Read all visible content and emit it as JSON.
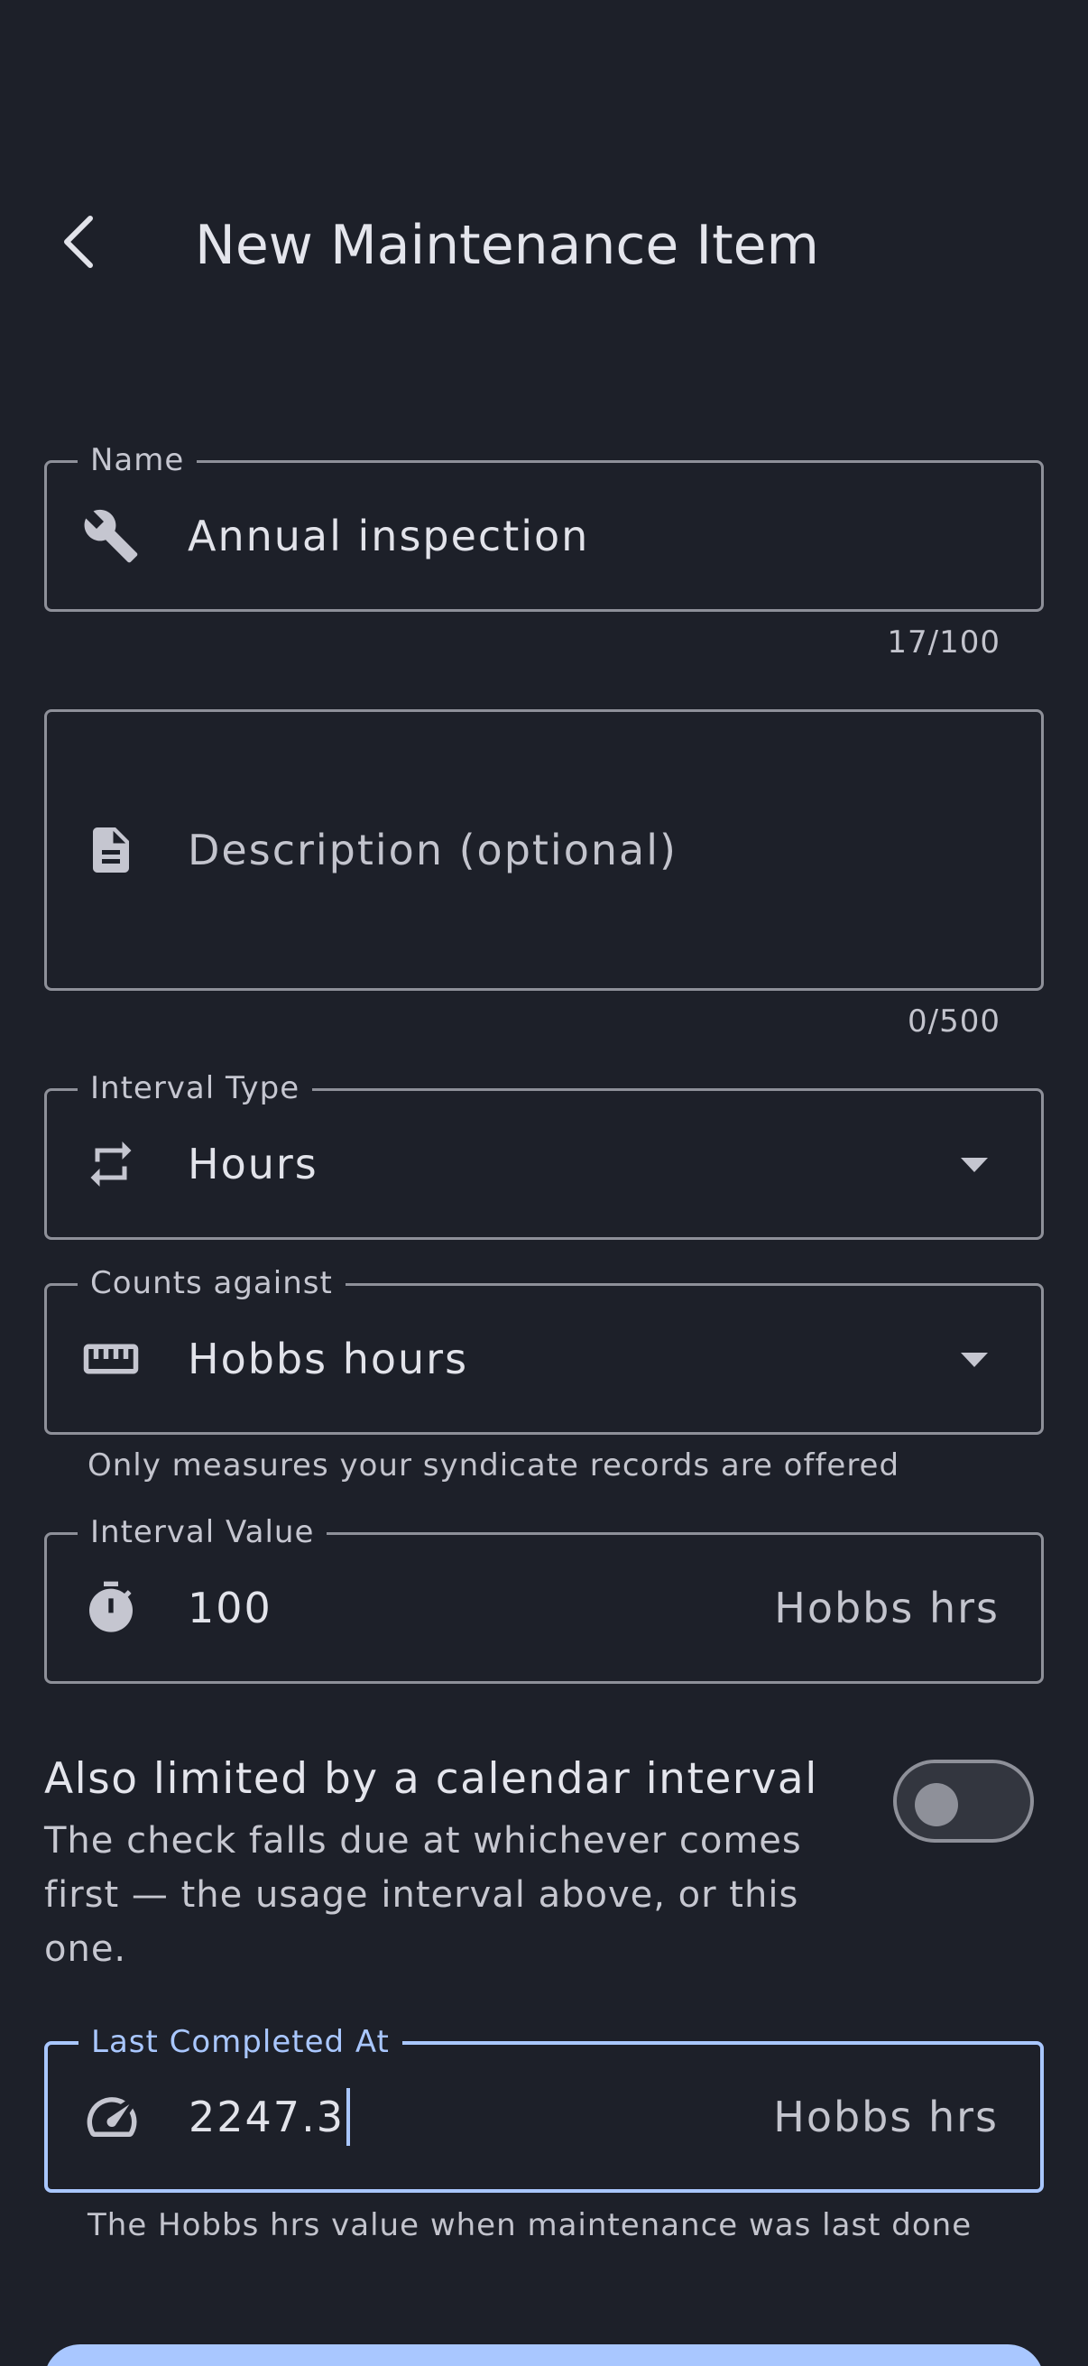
{
  "header": {
    "title": "New Maintenance Item"
  },
  "name_field": {
    "label": "Name",
    "value": "Annual inspection",
    "counter": "17/100",
    "icon": "wrench-icon"
  },
  "description_field": {
    "placeholder": "Description (optional)",
    "counter": "0/500",
    "icon": "description-icon"
  },
  "interval_type_field": {
    "label": "Interval Type",
    "value": "Hours",
    "icon": "repeat-icon"
  },
  "counts_against_field": {
    "label": "Counts against",
    "value": "Hobbs hours",
    "helper": "Only measures your syndicate records are offered",
    "icon": "ruler-icon"
  },
  "interval_value_field": {
    "label": "Interval Value",
    "value": "100",
    "suffix": "Hobbs hrs",
    "icon": "timer-icon"
  },
  "calendar_toggle": {
    "title": "Also limited by a calendar interval",
    "subtitle": "The check falls due at whichever comes first — the usage interval above, or this one.",
    "enabled": false
  },
  "last_completed_field": {
    "label": "Last Completed At",
    "value": "2247.3",
    "suffix": "Hobbs hrs",
    "helper": "The Hobbs hrs value when maintenance was last done",
    "icon": "speedometer-icon"
  },
  "colors": {
    "background": "#1d2029",
    "outline": "#8e9099",
    "accent": "#a9c7ff",
    "text": "#e2e3ea"
  }
}
